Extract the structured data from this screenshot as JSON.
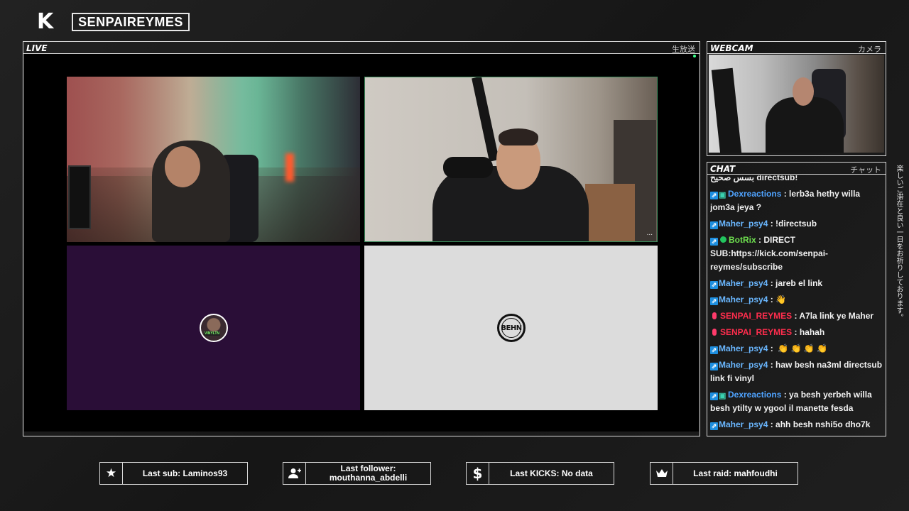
{
  "header": {
    "logo": "K",
    "channel_name": "SENPAIREYMES"
  },
  "live": {
    "label": "LIVE",
    "jp_label": "生放送",
    "tiles": [
      {
        "kind": "camera"
      },
      {
        "kind": "camera",
        "dots": "..."
      },
      {
        "kind": "avatar",
        "tag": "VINYLTN"
      },
      {
        "kind": "logo",
        "logo_text": "BEHN"
      }
    ]
  },
  "webcam": {
    "label": "WEBCAM",
    "jp_label": "カメラ"
  },
  "chat": {
    "label": "CHAT",
    "jp_label": "チャット",
    "top_text": "!directsub بسس صحيح",
    "messages": [
      {
        "user": "Dexreactions",
        "text": "lerb3a hethy willa jom3a jeya ?",
        "badges": [
          "kick",
          "x"
        ],
        "color": "blue2"
      },
      {
        "user": "Maher_psy4",
        "text": "!directsub",
        "badges": [
          "kick"
        ],
        "color": "blue"
      },
      {
        "user": "BotRix",
        "text": "DIRECT SUB:https://kick.com/senpai-reymes/subscribe",
        "badges": [
          "kick",
          "green"
        ],
        "color": "green"
      },
      {
        "user": "Maher_psy4",
        "text": "jareb el link",
        "badges": [
          "kick"
        ],
        "color": "blue"
      },
      {
        "user": "Maher_psy4",
        "text": "👋",
        "badges": [
          "kick"
        ],
        "color": "blue"
      },
      {
        "user": "SENPAI_REYMES",
        "text": "A7la link ye Maher",
        "badges": [
          "mic"
        ],
        "color": "red"
      },
      {
        "user": "SENPAI_REYMES",
        "text": "hahah",
        "badges": [
          "mic"
        ],
        "color": "red"
      },
      {
        "user": "Maher_psy4",
        "text": " 👏 👏 👏 👏",
        "badges": [
          "kick"
        ],
        "color": "blue"
      },
      {
        "user": "Maher_psy4",
        "text": "haw besh na3ml directsub link fi vinyl",
        "badges": [
          "kick"
        ],
        "color": "blue"
      },
      {
        "user": "Dexreactions",
        "text": "ya besh yerbeh willa besh ytilty w ygool il manette fesda",
        "badges": [
          "kick",
          "x"
        ],
        "color": "blue2"
      },
      {
        "user": "Maher_psy4",
        "text": "ahh besh nshi5o dho7k",
        "badges": [
          "kick"
        ],
        "color": "blue"
      }
    ]
  },
  "side_text": "楽しいご滞在と良い一日をお祈りしております。",
  "stats": {
    "last_sub": "Last sub: Laminos93",
    "last_follower_line1": "Last follower:",
    "last_follower_line2": "mouthanna_abdelli",
    "last_kicks": "Last KICKS: No data",
    "last_raid": "Last raid: mahfoudhi"
  },
  "colors": {
    "accent_green": "#3cff8a",
    "kick_blue": "#1e8fe0",
    "user_red": "#ff2d4d",
    "user_green": "#6ee04f",
    "user_blue": "#6ab7ff"
  }
}
